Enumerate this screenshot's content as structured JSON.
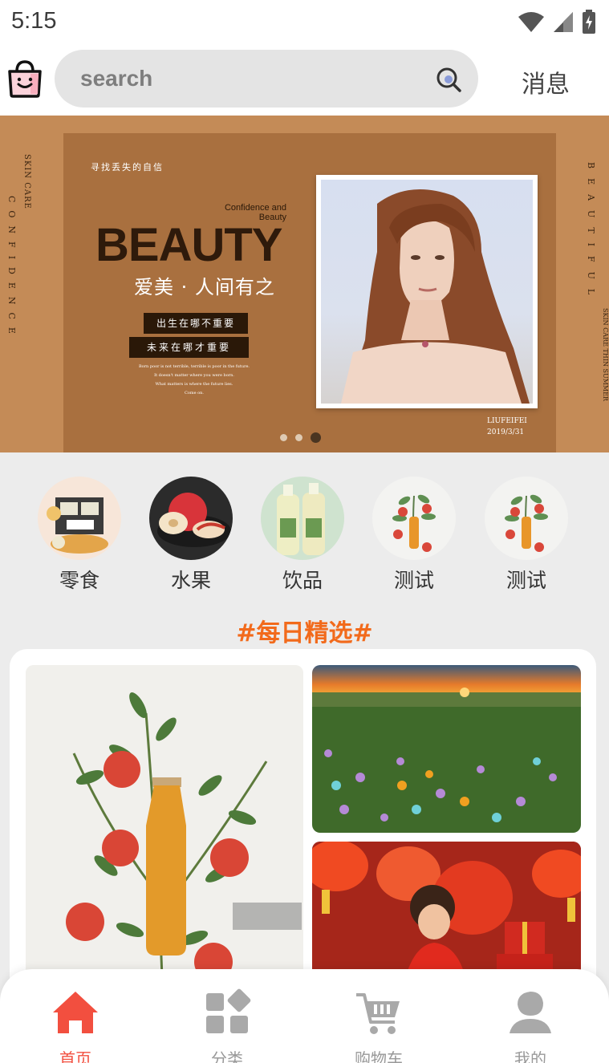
{
  "status_bar": {
    "time": "5:15"
  },
  "top_bar": {
    "search_placeholder": "search",
    "message_label": "消息"
  },
  "banner": {
    "small_cn": "寻找丢失的自信",
    "side_left_top": "SKIN CARE",
    "side_left": "CONFIDENCE",
    "side_right": "BEAUTIFUL",
    "side_right_small": "SKIN CARE THIN SUMMER",
    "confidence": "Confidence and Beauty",
    "headline": "BEAUTY",
    "subtitle": "爱美 · 人间有之",
    "pill1": "出生在哪不重要",
    "pill2": "未来在哪才重要",
    "english_lines": [
      "Born poor is not terrible, terrible is poor in the future.",
      "It doesn't matter where you were born.",
      "What matters is where the future lies.",
      "Come on."
    ],
    "sign_name": "LIUFEIFEI",
    "sign_date": "2019/3/31",
    "active_slide": 3,
    "slide_count": 3
  },
  "categories": [
    {
      "label": "零食"
    },
    {
      "label": "水果"
    },
    {
      "label": "饮品"
    },
    {
      "label": "测试"
    },
    {
      "label": "测试"
    }
  ],
  "daily": {
    "title": "#每日精选#"
  },
  "tabs": [
    {
      "label": "首页",
      "icon": "home-icon",
      "active": true
    },
    {
      "label": "分类",
      "icon": "category-icon",
      "active": false
    },
    {
      "label": "购物车",
      "icon": "cart-icon",
      "active": false
    },
    {
      "label": "我的",
      "icon": "user-icon",
      "active": false
    }
  ],
  "colors": {
    "accent": "#f24f3f",
    "daily_title": "#f26a1b",
    "banner_bg": "#c48b57",
    "tab_inactive": "#a9a9a9"
  }
}
